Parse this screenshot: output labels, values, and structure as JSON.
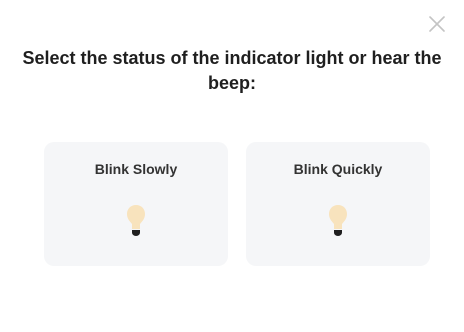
{
  "dialog": {
    "title": "Select the status of the indicator light or hear the beep:",
    "close_icon": "close-icon"
  },
  "options": [
    {
      "label": "Blink Slowly",
      "icon": "light-bulb-icon"
    },
    {
      "label": "Blink Quickly",
      "icon": "light-bulb-icon"
    }
  ],
  "colors": {
    "bulb_glow": "#f8e3bd",
    "bulb_base": "#1f1f1f",
    "card_background": "#f5f6f8",
    "close_icon": "#c4c4c4"
  }
}
